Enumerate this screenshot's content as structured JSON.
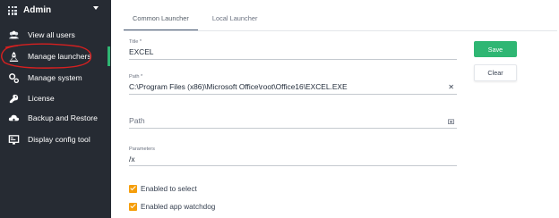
{
  "sidebar": {
    "header": {
      "title": "Admin",
      "icon": "grid-icon"
    },
    "items": [
      {
        "label": "View all users",
        "icon": "users-icon"
      },
      {
        "label": "Manage launchers",
        "icon": "rocket-icon",
        "active": true
      },
      {
        "label": "Manage system",
        "icon": "gears-icon"
      },
      {
        "label": "License",
        "icon": "key-icon"
      },
      {
        "label": "Backup and Restore",
        "icon": "cloud-upload-icon"
      },
      {
        "label": "Display config tool",
        "icon": "display-icon"
      }
    ],
    "active_color": "#2fb673"
  },
  "main": {
    "tabs": [
      {
        "label": "Common Launcher",
        "active": true
      },
      {
        "label": "Local Launcher",
        "active": false
      }
    ],
    "form": {
      "title": {
        "label": "Title *",
        "value": "EXCEL"
      },
      "path": {
        "label": "Path *",
        "value": "C:\\Program Files (x86)\\Microsoft Office\\root\\Office16\\EXCEL.EXE"
      },
      "path2": {
        "placeholder": "Path"
      },
      "parameters": {
        "label": "Parameters",
        "value": "/x"
      },
      "checkboxes": [
        {
          "label": "Enabled to select",
          "checked": true
        },
        {
          "label": "Enabled app watchdog",
          "checked": true
        }
      ]
    },
    "buttons": {
      "save": "Save",
      "clear": "Clear"
    }
  },
  "colors": {
    "sidebar_bg": "#262b33",
    "accent": "#2fb673",
    "checkbox": "#f59e0b",
    "annotation": "#d62020"
  }
}
